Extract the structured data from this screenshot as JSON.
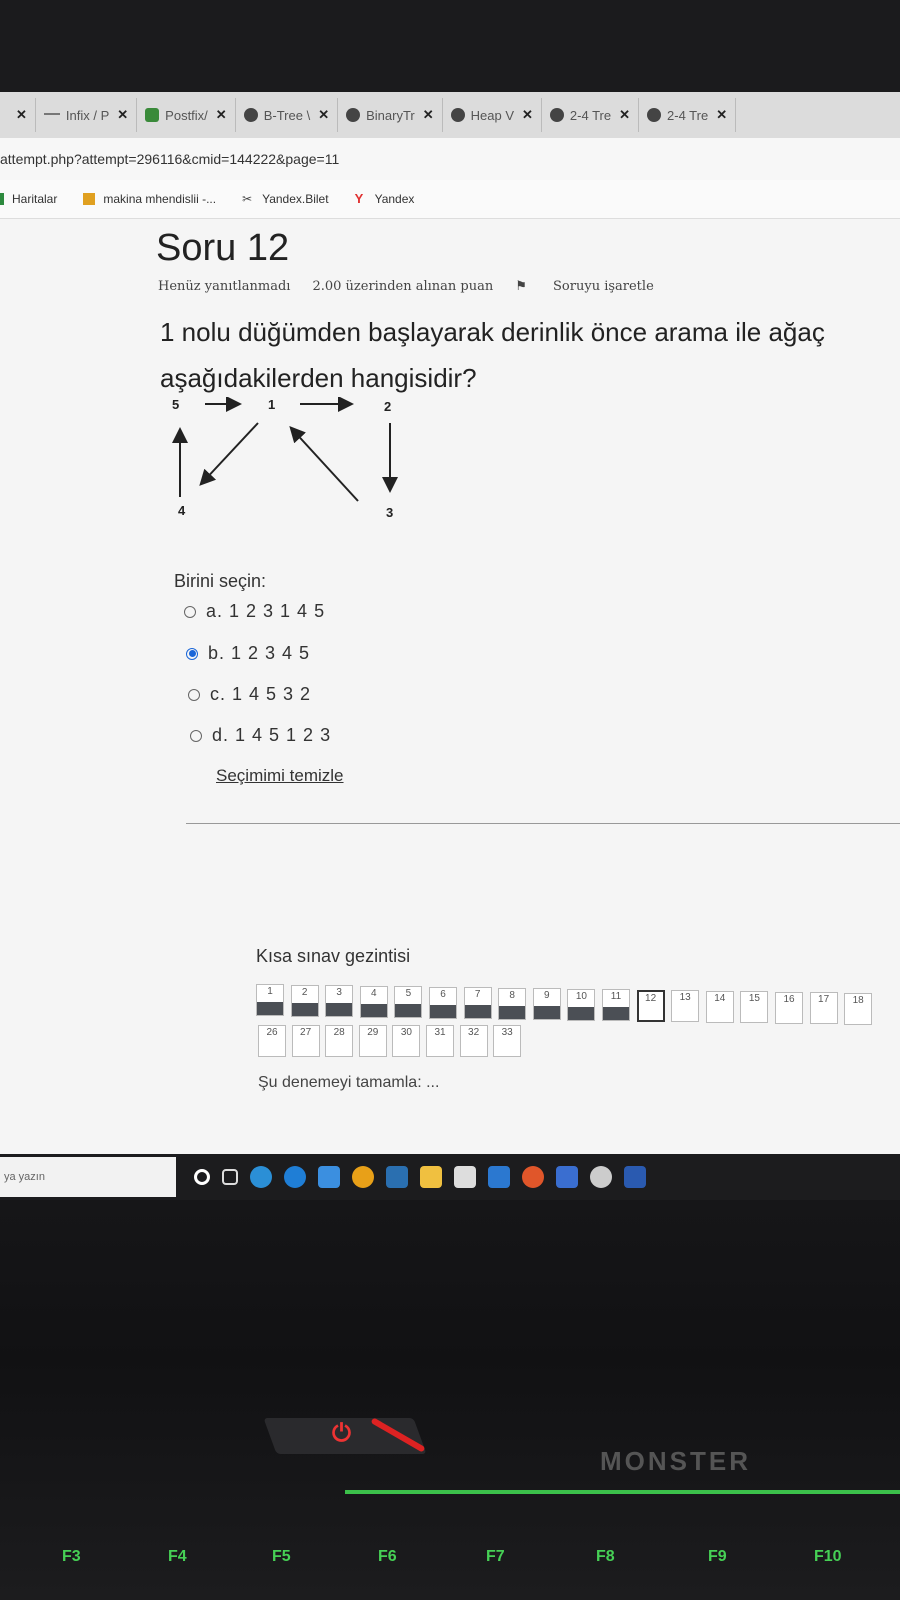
{
  "browser": {
    "tabs": [
      {
        "label": "Infix / P",
        "icon": "line-icon"
      },
      {
        "label": "Postfix/",
        "icon": "leaf-icon"
      },
      {
        "label": "B-Tree \\",
        "icon": "globe-icon"
      },
      {
        "label": "BinaryTr",
        "icon": "globe-icon"
      },
      {
        "label": "Heap V",
        "icon": "globe-icon"
      },
      {
        "label": "2-4 Tre",
        "icon": "globe-icon"
      },
      {
        "label": "2-4 Tre",
        "icon": "globe-icon"
      }
    ],
    "url": "attempt.php?attempt=296116&cmid=144222&page=11",
    "bookmarks": [
      "Haritalar",
      "makina mhendislii -...",
      "Yandex.Bilet",
      "Yandex"
    ]
  },
  "question": {
    "title": "Soru 12",
    "status": "Henüz yanıtlanmadı",
    "points": "2.00 üzerinden alınan puan",
    "flag": "Soruyu işaretle",
    "text_line1": "1 nolu düğümden başlayarak derinlik önce arama ile ağaç",
    "text_line2": "aşağıdakilerden hangisidir?",
    "choose_label": "Birini seçin:",
    "options": [
      {
        "label": "a. 1 2 3 1 4 5",
        "selected": false
      },
      {
        "label": "b. 1 2 3 4 5",
        "selected": true
      },
      {
        "label": "c. 1 4 5 3 2",
        "selected": false
      },
      {
        "label": "d. 1 4 5 1 2 3",
        "selected": false
      }
    ],
    "clear_label": "Seçimimi temizle"
  },
  "graph": {
    "nodes": [
      "5",
      "1",
      "2",
      "4",
      "3"
    ],
    "edges": [
      [
        "5",
        "1"
      ],
      [
        "1",
        "2"
      ],
      [
        "2",
        "3"
      ],
      [
        "4",
        "5"
      ],
      [
        "1",
        "4"
      ],
      [
        "3",
        "1"
      ]
    ]
  },
  "quiz_nav": {
    "title": "Kısa sınav gezintisi",
    "row1": [
      "1",
      "2",
      "3",
      "4",
      "5",
      "6",
      "7",
      "8",
      "9",
      "10",
      "11",
      "12",
      "13",
      "14",
      "15",
      "16",
      "17",
      "18"
    ],
    "row2": [
      "26",
      "27",
      "28",
      "29",
      "30",
      "31",
      "32",
      "33"
    ],
    "answered": [
      "1",
      "2",
      "3",
      "4",
      "5",
      "6",
      "7",
      "8",
      "9",
      "10",
      "11"
    ],
    "current": "12",
    "finish_label": "Şu denemeyi tamamla: ..."
  },
  "taskbar": {
    "search_placeholder": "ya yazın"
  },
  "laptop": {
    "brand": "MONSTER",
    "fkeys": [
      "F3",
      "F4",
      "F5",
      "F6",
      "F7",
      "F8",
      "F9",
      "F10"
    ]
  }
}
